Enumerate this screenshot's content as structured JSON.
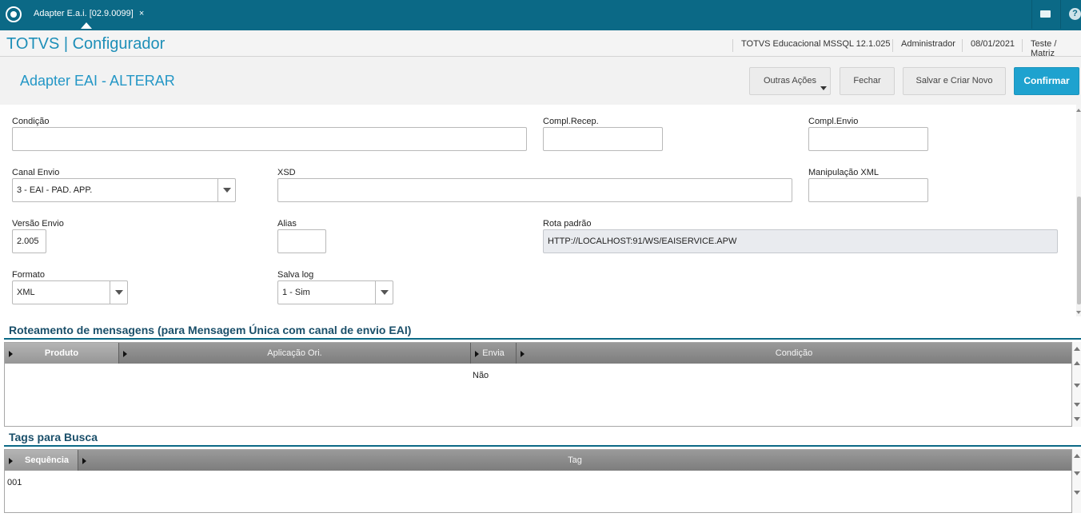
{
  "tabbar": {
    "tab_label": "Adapter E.a.i. [02.9.0099]",
    "close_glyph": "×",
    "icons": [
      "totvs-logo-icon",
      "mail-icon",
      "help-icon"
    ]
  },
  "header": {
    "app_title": "TOTVS | Configurador",
    "environment": "TOTVS Educacional MSSQL 12.1.025",
    "user": "Administrador",
    "date": "08/01/2021",
    "company": "Teste / Matriz"
  },
  "actionbar": {
    "page_title": "Adapter EAI - ALTERAR",
    "buttons": {
      "other_actions": "Outras Ações",
      "close": "Fechar",
      "save_new": "Salvar e Criar Novo",
      "confirm": "Confirmar"
    }
  },
  "form": {
    "condicao": {
      "label": "Condição",
      "value": ""
    },
    "compl_recep": {
      "label": "Compl.Recep.",
      "value": ""
    },
    "compl_envio": {
      "label": "Compl.Envio",
      "value": ""
    },
    "canal_envio": {
      "label": "Canal Envio",
      "value": "3 - EAI - PAD. APP."
    },
    "xsd": {
      "label": "XSD",
      "value": ""
    },
    "manipulacao_xml": {
      "label": "Manipulação XML",
      "value": ""
    },
    "versao_envio": {
      "label": "Versão Envio",
      "value": "2.005"
    },
    "alias": {
      "label": "Alias",
      "value": ""
    },
    "rota_padrao": {
      "label": "Rota padrão",
      "value": "HTTP://LOCALHOST:91/WS/EAISERVICE.APW"
    },
    "formato": {
      "label": "Formato",
      "value": "XML"
    },
    "salva_log": {
      "label": "Salva log",
      "value": "1 - Sim"
    }
  },
  "routing": {
    "title": "Roteamento de mensagens (para Mensagem Única com canal de envio EAI)",
    "columns": [
      "Produto",
      "Aplicação Ori.",
      "Envia",
      "Condição"
    ],
    "rows": [
      {
        "produto": "",
        "aplicacao": "",
        "envia": "Não",
        "condicao": ""
      }
    ]
  },
  "tags": {
    "title": "Tags para Busca",
    "columns": [
      "Sequência",
      "Tag"
    ],
    "rows": [
      {
        "sequencia": "001",
        "tag": ""
      }
    ]
  },
  "colors": {
    "topbar": "#0b6986",
    "accent": "#1ea2cf",
    "title_blue": "#1e8fb8",
    "section_title": "#1a4f6a"
  }
}
